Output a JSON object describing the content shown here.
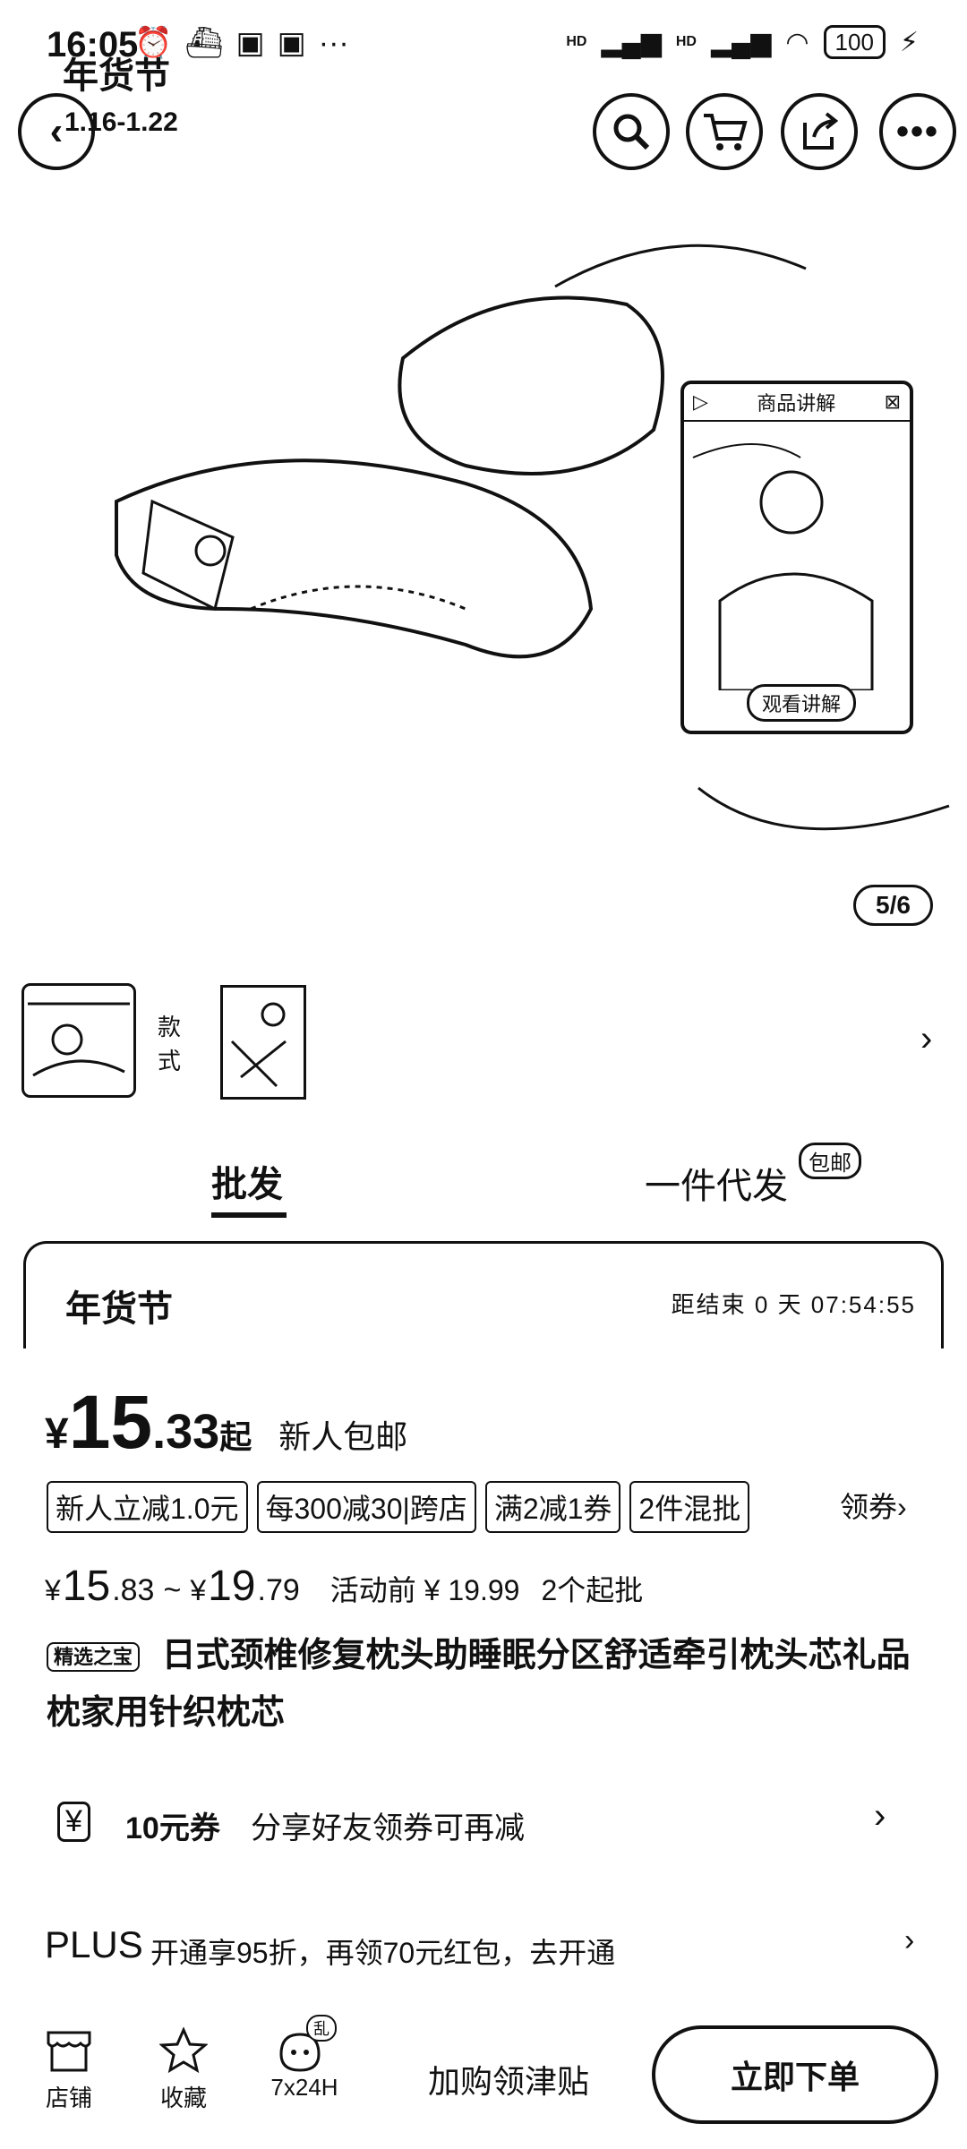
{
  "status_bar": {
    "time": "16:05",
    "network_labels": [
      "HD",
      "HD"
    ],
    "battery": "100"
  },
  "top_overlay": {
    "event_title": "年货节",
    "event_date": "1.16-1.22"
  },
  "hero": {
    "video_card_title": "商品讲解",
    "video_card_button": "观看讲解",
    "pager": "5/6"
  },
  "style_selector": {
    "label": "款式"
  },
  "tabs": {
    "wholesale": "批发",
    "dropship": "一件代发",
    "dropship_badge": "包邮"
  },
  "promo_card": {
    "title": "年货节",
    "countdown": "距结束 0 天 07:54:55"
  },
  "price": {
    "currency": "¥",
    "integer": "15",
    "decimal": ".33",
    "suffix": "起",
    "shipping": "新人包邮"
  },
  "tags": [
    "新人立减1.0元",
    "每300减30|跨店",
    "满2减1券",
    "2件混批"
  ],
  "coupon_link": "领券",
  "price_range": {
    "low_currency": "¥",
    "low_int": "15",
    "low_dec": ".83",
    "sep": "~",
    "high_currency": "¥",
    "high_int": "19",
    "high_dec": ".79",
    "before_event": "活动前 ¥ 19.99",
    "min_order": "2个起批"
  },
  "product": {
    "store_badge": "精选之宝",
    "title": "日式颈椎修复枕头助睡眠分区舒适牵引枕头芯礼品枕家用针织枕芯"
  },
  "coupon_row": {
    "amount": "10元券",
    "desc": "分享好友领券可再减"
  },
  "plus_row": {
    "brand": "PLUS",
    "text": "开通享95折，再领70元红包，去开通"
  },
  "bottom_bar": {
    "shop": "店铺",
    "favorite": "收藏",
    "service": "7x24H",
    "service_badge": "乱",
    "add_cart": "加购领津贴",
    "buy_now": "立即下单"
  }
}
